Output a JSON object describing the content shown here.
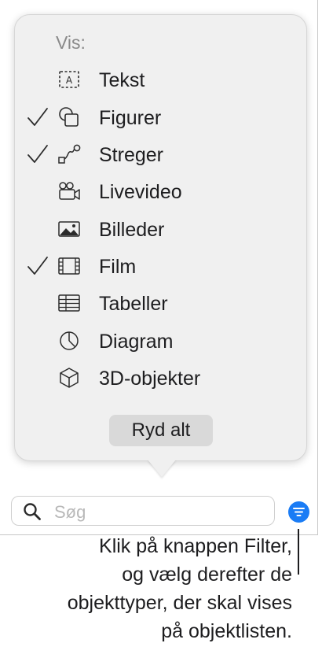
{
  "popover": {
    "section_label": "Vis:",
    "items": [
      {
        "label": "Tekst",
        "icon": "text-box-icon",
        "checked": false
      },
      {
        "label": "Figurer",
        "icon": "shapes-icon",
        "checked": true
      },
      {
        "label": "Streger",
        "icon": "line-icon",
        "checked": true
      },
      {
        "label": "Livevideo",
        "icon": "live-video-icon",
        "checked": false
      },
      {
        "label": "Billeder",
        "icon": "image-icon",
        "checked": false
      },
      {
        "label": "Film",
        "icon": "film-icon",
        "checked": true
      },
      {
        "label": "Tabeller",
        "icon": "table-icon",
        "checked": false
      },
      {
        "label": "Diagram",
        "icon": "pie-chart-icon",
        "checked": false
      },
      {
        "label": "3D-objekter",
        "icon": "cube-icon",
        "checked": false
      }
    ],
    "clear_button": "Ryd alt"
  },
  "search": {
    "placeholder": "Søg"
  },
  "filter_button": {
    "icon": "filter-icon",
    "color": "#1a7cf5"
  },
  "caption": {
    "lines": [
      "Klik på knappen Filter,",
      "og vælg derefter de",
      "objekttyper, der skal vises",
      "på objektlisten."
    ]
  }
}
